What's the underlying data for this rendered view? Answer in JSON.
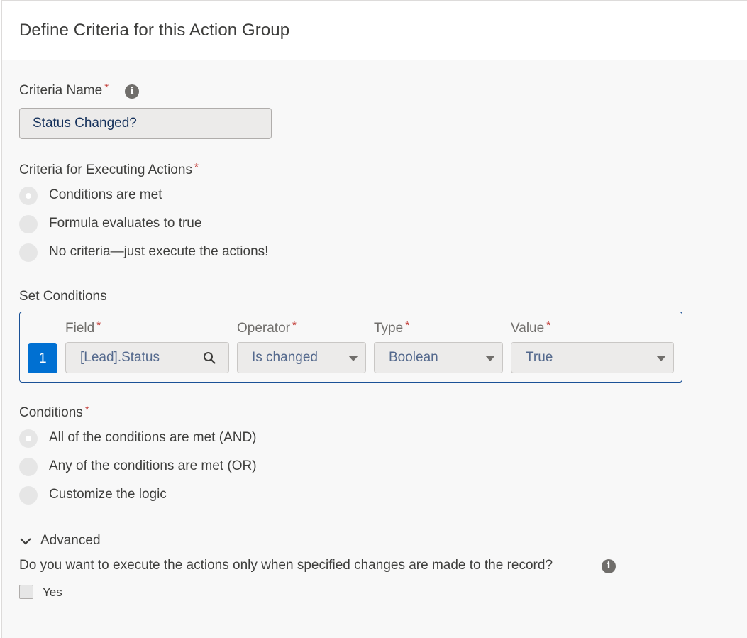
{
  "header": {
    "title": "Define Criteria for this Action Group"
  },
  "criteria_name": {
    "label": "Criteria Name",
    "required_mark": "*",
    "info_icon": "info-icon",
    "value": "Status Changed?"
  },
  "executing_actions": {
    "label": "Criteria for Executing Actions",
    "required_mark": "*",
    "options": [
      {
        "label": "Conditions are met",
        "selected": true
      },
      {
        "label": "Formula evaluates to true",
        "selected": false
      },
      {
        "label": "No criteria—just execute the actions!",
        "selected": false
      }
    ]
  },
  "set_conditions": {
    "label": "Set Conditions",
    "columns": {
      "field": "Field",
      "operator": "Operator",
      "type": "Type",
      "value": "Value"
    },
    "required_mark": "*",
    "rows": [
      {
        "number": "1",
        "field": "[Lead].Status",
        "operator": "Is changed",
        "type": "Boolean",
        "value": "True"
      }
    ],
    "accent_color": "#0070d2"
  },
  "conditions": {
    "label": "Conditions",
    "required_mark": "*",
    "options": [
      {
        "label": "All of the conditions are met (AND)",
        "selected": true
      },
      {
        "label": "Any of the conditions are met (OR)",
        "selected": false
      },
      {
        "label": "Customize the logic",
        "selected": false
      }
    ]
  },
  "advanced": {
    "toggle_label": "Advanced",
    "question": "Do you want to execute the actions only when specified changes are made to the record?",
    "checkbox_label": "Yes",
    "checked": false
  }
}
